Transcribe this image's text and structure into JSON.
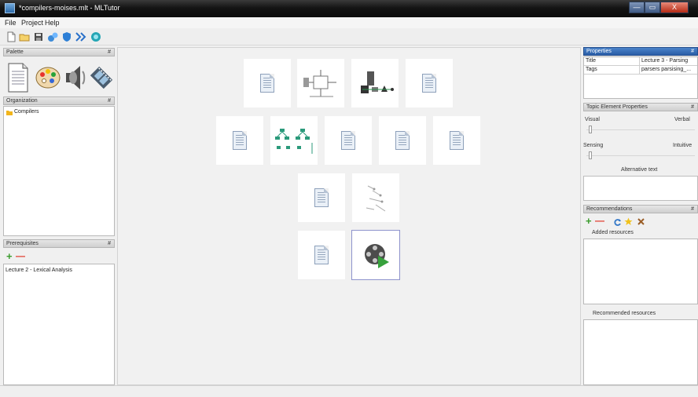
{
  "window": {
    "title": "*compilers-moises.mlt - MLTutor",
    "buttons": [
      "—",
      "▭",
      "X"
    ]
  },
  "menu": [
    "File",
    "Project",
    "Help"
  ],
  "toolbar": {
    "icons": [
      "new-file-icon",
      "open-folder-icon",
      "save-icon",
      "publish-icon",
      "shield-icon",
      "next-icon",
      "go-icon"
    ]
  },
  "palette": {
    "title": "Palette",
    "icons": [
      "document-icon",
      "palette-colors-icon",
      "speaker-icon",
      "film-icon"
    ]
  },
  "organization": {
    "title": "Organization",
    "items": [
      "Compilers"
    ]
  },
  "prerequisites": {
    "title": "Prerequisites",
    "items": [
      "Lecture 2 - Lexical Analysis"
    ]
  },
  "properties": {
    "title": "Properties",
    "rows": [
      {
        "key": "Title",
        "value": "Lecture 3 - Parsing"
      },
      {
        "key": "Tags",
        "value": "parsers parsising_..."
      }
    ]
  },
  "topic_element_properties": {
    "title": "Topic Element Properties",
    "visual": "Visual",
    "verbal": "Verbal",
    "sensing": "Sensing",
    "intuitive": "Intuitive",
    "alt_text_label": "Alternative text"
  },
  "recommendations": {
    "title": "Recommendations",
    "added_label": "Added resources",
    "recommended_label": "Recommended resources"
  },
  "canvas": {
    "rows": [
      [
        "document",
        "diagram",
        "diagram",
        "document"
      ],
      [
        "document",
        "diagram",
        "document",
        "document",
        "document"
      ],
      [
        "document",
        "sketch"
      ],
      [
        "document",
        "film"
      ]
    ]
  },
  "glyphs": {
    "pin": "#",
    "add": "+",
    "remove": "—"
  }
}
